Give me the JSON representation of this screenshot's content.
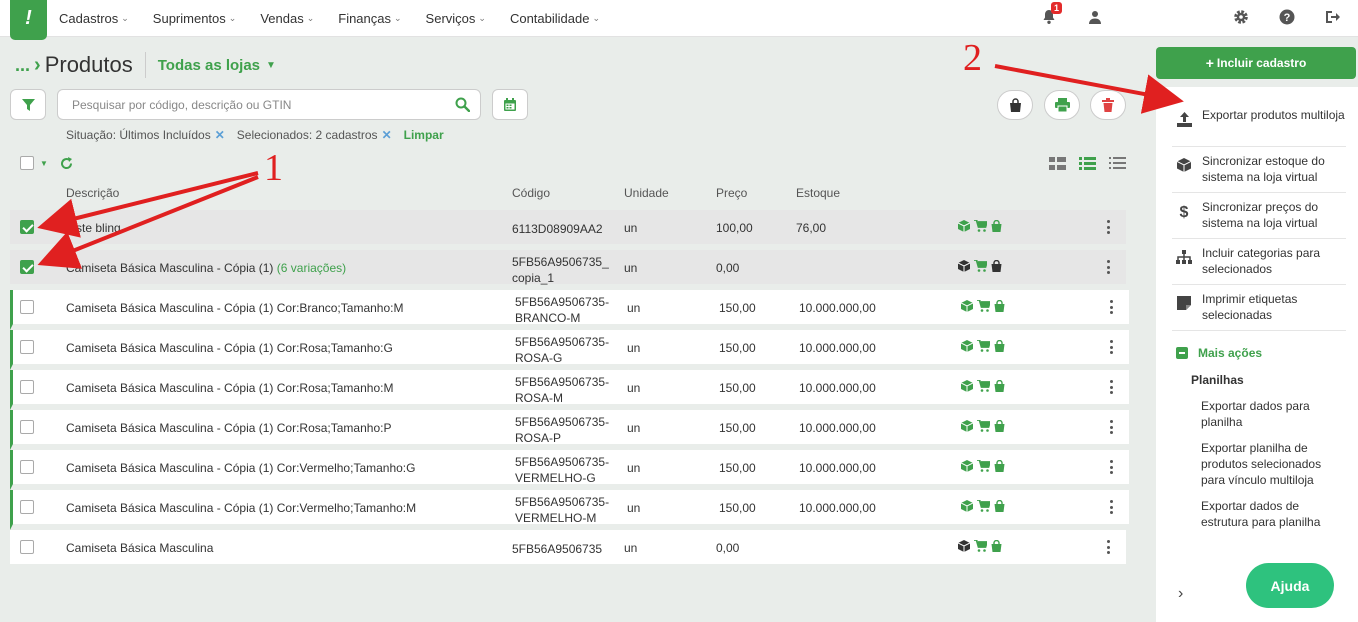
{
  "nav": {
    "logo": "!",
    "menu": [
      {
        "label": "Cadastros"
      },
      {
        "label": "Suprimentos"
      },
      {
        "label": "Vendas"
      },
      {
        "label": "Finanças"
      },
      {
        "label": "Serviços"
      },
      {
        "label": "Contabilidade"
      }
    ],
    "notification_count": "1"
  },
  "header": {
    "breadcrumb_dots": "...",
    "title": "Produtos",
    "store_selector": "Todas as lojas"
  },
  "search": {
    "placeholder": "Pesquisar por código, descrição ou GTIN",
    "value": ""
  },
  "filters": {
    "situacao": "Situação: Últimos Incluídos",
    "selecionados": "Selecionados: 2 cadastros",
    "clear_label": "Limpar"
  },
  "table": {
    "columns": {
      "descricao": "Descrição",
      "codigo": "Código",
      "unidade": "Unidade",
      "preco": "Preço",
      "estoque": "Estoque"
    },
    "rows": [
      {
        "checked": true,
        "desc": "teste bling",
        "extra": "",
        "code1": "6113D08909AA2",
        "code2": "",
        "unit": "un",
        "price": "100,00",
        "stock": "76,00",
        "style": "sel",
        "box": "green"
      },
      {
        "checked": true,
        "desc": "Camiseta Básica Masculina - Cópia (1)",
        "extra": "(6 variações)",
        "code1": "5FB56A9506735_",
        "code2": "copia_1",
        "unit": "un",
        "price": "0,00",
        "stock": "",
        "style": "sel",
        "box": "dark"
      },
      {
        "checked": false,
        "desc": "Camiseta Básica Masculina - Cópia (1) Cor:Branco;Tamanho:M",
        "extra": "",
        "code1": "5FB56A9506735-",
        "code2": "BRANCO-M",
        "unit": "un",
        "price": "150,00",
        "stock": "10.000.000,00",
        "style": "var",
        "box": "green"
      },
      {
        "checked": false,
        "desc": "Camiseta Básica Masculina - Cópia (1) Cor:Rosa;Tamanho:G",
        "extra": "",
        "code1": "5FB56A9506735-",
        "code2": "ROSA-G",
        "unit": "un",
        "price": "150,00",
        "stock": "10.000.000,00",
        "style": "var",
        "box": "green"
      },
      {
        "checked": false,
        "desc": "Camiseta Básica Masculina - Cópia (1) Cor:Rosa;Tamanho:M",
        "extra": "",
        "code1": "5FB56A9506735-",
        "code2": "ROSA-M",
        "unit": "un",
        "price": "150,00",
        "stock": "10.000.000,00",
        "style": "var",
        "box": "green"
      },
      {
        "checked": false,
        "desc": "Camiseta Básica Masculina - Cópia (1) Cor:Rosa;Tamanho:P",
        "extra": "",
        "code1": "5FB56A9506735-",
        "code2": "ROSA-P",
        "unit": "un",
        "price": "150,00",
        "stock": "10.000.000,00",
        "style": "var",
        "box": "green"
      },
      {
        "checked": false,
        "desc": "Camiseta Básica Masculina - Cópia (1) Cor:Vermelho;Tamanho:G",
        "extra": "",
        "code1": "5FB56A9506735-",
        "code2": "VERMELHO-G",
        "unit": "un",
        "price": "150,00",
        "stock": "10.000.000,00",
        "style": "var",
        "box": "green"
      },
      {
        "checked": false,
        "desc": "Camiseta Básica Masculina - Cópia (1) Cor:Vermelho;Tamanho:M",
        "extra": "",
        "code1": "5FB56A9506735-",
        "code2": "VERMELHO-M",
        "unit": "un",
        "price": "150,00",
        "stock": "10.000.000,00",
        "style": "var",
        "box": "green"
      },
      {
        "checked": false,
        "desc": "Camiseta Básica Masculina",
        "extra": "",
        "code1": "5FB56A9506735",
        "code2": "",
        "unit": "un",
        "price": "0,00",
        "stock": "",
        "style": "plain",
        "box": "dark"
      }
    ]
  },
  "side": {
    "add_button": "Incluir cadastro",
    "actions": [
      {
        "icon": "upload-icon",
        "label": "Exportar produtos multiloja"
      },
      {
        "icon": "box-icon",
        "label": "Sincronizar estoque do sistema na loja virtual"
      },
      {
        "icon": "dollar-icon",
        "label": "Sincronizar preços do sistema na loja virtual"
      },
      {
        "icon": "sitemap-icon",
        "label": "Incluir categorias para selecionados"
      },
      {
        "icon": "label-icon",
        "label": "Imprimir etiquetas selecionadas"
      }
    ],
    "more_label": "Mais ações",
    "planilhas_title": "Planilhas",
    "planilhas": [
      "Exportar dados para planilha",
      "Exportar planilha de produtos selecionados para vínculo multiloja",
      "Exportar dados de estrutura para planilha"
    ],
    "help_button": "Ajuda"
  },
  "annotations": {
    "one": "1",
    "two": "2"
  },
  "colors": {
    "accent": "#3fa14c",
    "arrow": "#e02020",
    "help": "#2ec27e"
  }
}
